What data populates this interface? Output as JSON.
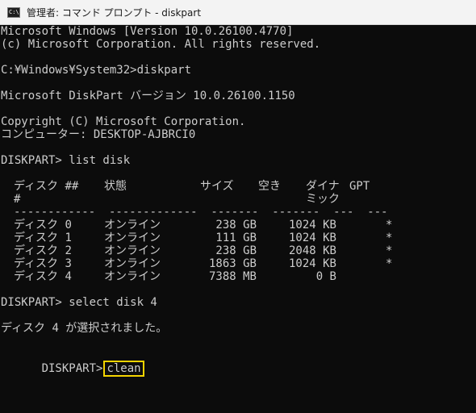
{
  "window": {
    "title": "管理者: コマンド プロンプト - diskpart",
    "icon_label": "C:\\"
  },
  "console": {
    "banner_1": "Microsoft Windows [Version 10.0.26100.4770]",
    "banner_2": "(c) Microsoft Corporation. All rights reserved.",
    "prompt_1": "C:¥Windows¥System32>diskpart",
    "diskpart_version": "Microsoft DiskPart バージョン 10.0.26100.1150",
    "copyright": "Copyright (C) Microsoft Corporation.",
    "computer": "コンピューター: DESKTOP-AJBRCI0",
    "cmd_list": "DISKPART> list disk",
    "table": {
      "headers": {
        "disk": "ディスク ###",
        "status": "状態",
        "size": "サイズ",
        "free": "空き",
        "dyn": "ダイナミック",
        "gpt": "GPT"
      },
      "rows": [
        {
          "disk": "ディスク 0",
          "status": "オンライン",
          "size": "238 GB",
          "free": "1024 KB",
          "dyn": "",
          "gpt": "*"
        },
        {
          "disk": "ディスク 1",
          "status": "オンライン",
          "size": "111 GB",
          "free": "1024 KB",
          "dyn": "",
          "gpt": "*"
        },
        {
          "disk": "ディスク 2",
          "status": "オンライン",
          "size": "238 GB",
          "free": "2048 KB",
          "dyn": "",
          "gpt": "*"
        },
        {
          "disk": "ディスク 3",
          "status": "オンライン",
          "size": "1863 GB",
          "free": "1024 KB",
          "dyn": "",
          "gpt": "*"
        },
        {
          "disk": "ディスク 4",
          "status": "オンライン",
          "size": "7388 MB",
          "free": "0 B",
          "dyn": "",
          "gpt": ""
        }
      ]
    },
    "cmd_select": "DISKPART> select disk 4",
    "select_result": "ディスク 4 が選択されました。",
    "prompt_final": "DISKPART>",
    "typed_command": "clean",
    "highlight_color": "#f4d400",
    "text_color": "#cccccc",
    "background_color": "#0c0c0c"
  }
}
